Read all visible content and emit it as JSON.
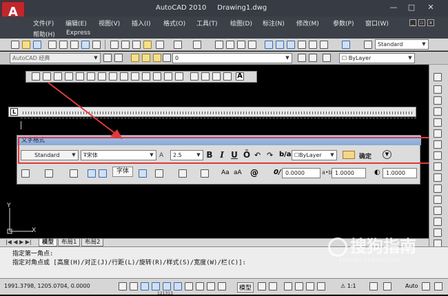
{
  "title": {
    "app": "AutoCAD 2010",
    "doc": "Drawing1.dwg",
    "minimize": "—",
    "maximize": "□",
    "close": "✕"
  },
  "app_logo": "A",
  "menu": [
    "文件(F)",
    "编辑(E)",
    "视图(V)",
    "插入(I)",
    "格式(O)",
    "工具(T)",
    "绘图(D)",
    "标注(N)",
    "修改(M)",
    "参数(P)",
    "窗口(W)",
    "帮助(H)",
    "Express"
  ],
  "toolbar": {
    "text_style": "Standard"
  },
  "workspace": {
    "name": "AutoCAD 经典",
    "layer": "0",
    "color": "ByLayer"
  },
  "ruler": {
    "left_marker": "L"
  },
  "text_format": {
    "title": "文字格式",
    "style": "Standard",
    "font": "宋体",
    "height": "2.5",
    "bold": "B",
    "italic": "I",
    "underline": "U",
    "overline": "Ō",
    "color": "ByLayer",
    "ok": "确定",
    "oblique": "0.0000",
    "tracking": "1.0000",
    "width": "1.0000",
    "font_tooltip": "字体",
    "aa_upper": "Aa",
    "aa_lower": "aA",
    "at_symbol": "@"
  },
  "ucs": {
    "x": "X",
    "y": "Y"
  },
  "tabs": [
    "模型",
    "布局1",
    "布局2"
  ],
  "command": {
    "line1": "指定第一角点:",
    "line2": "指定对角点或 [高度(H)/对正(J)/行距(L)/旋转(R)/样式(S)/宽度(W)/栏(C)]:"
  },
  "status": {
    "coords": "1991.3798, 1205.0704, 0.0000",
    "model": "模型",
    "scale": "1:1",
    "auto": "Auto",
    "bottom": "121313"
  },
  "watermark": {
    "main": "搜狗指南",
    "sub": "zhinan.sogou.com"
  },
  "colors": {
    "annotation_red": "#e03a3a",
    "title_blue": "#a9c2e6",
    "canvas": "#000000"
  }
}
